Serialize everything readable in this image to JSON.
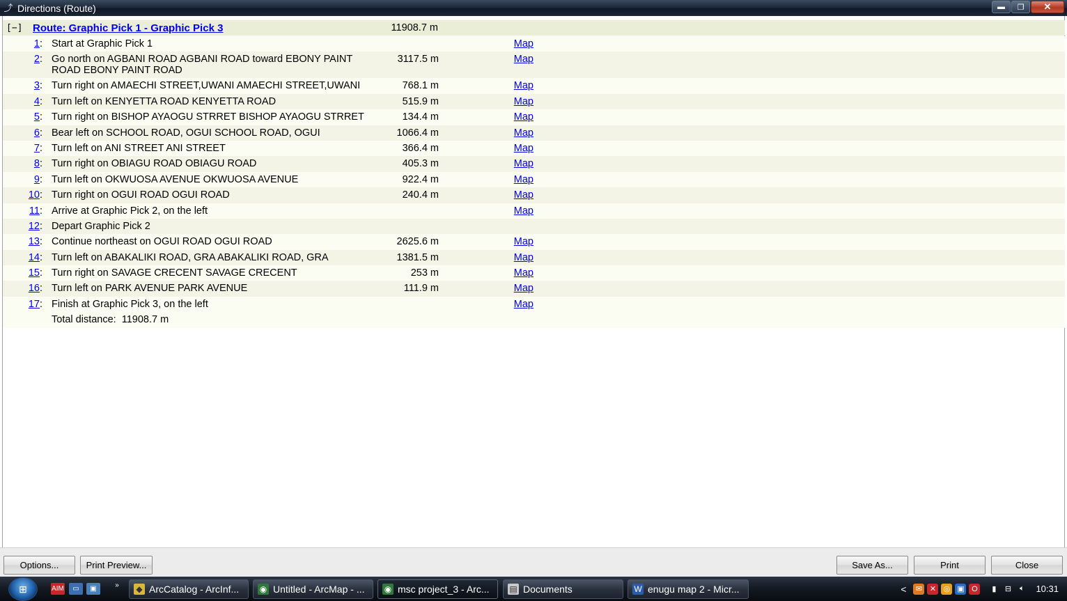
{
  "window": {
    "title": "Directions (Route)",
    "minimize": "▬",
    "restore": "❐",
    "close": "✕"
  },
  "route": {
    "collapse": "[−]",
    "title": "Route: Graphic Pick 1 - Graphic Pick 3",
    "total": "11908.7 m"
  },
  "steps": [
    {
      "num": "1",
      "desc": "Start at Graphic Pick 1",
      "dist": "",
      "map": "Map"
    },
    {
      "num": "2",
      "desc": "Go north on AGBANI ROAD AGBANI ROAD toward EBONY PAINT ROAD EBONY PAINT ROAD",
      "dist": "3117.5 m",
      "map": "Map"
    },
    {
      "num": "3",
      "desc": "Turn right on AMAECHI STREET,UWANI AMAECHI STREET,UWANI",
      "dist": "768.1 m",
      "map": "Map"
    },
    {
      "num": "4",
      "desc": "Turn left on KENYETTA ROAD KENYETTA ROAD",
      "dist": "515.9 m",
      "map": "Map"
    },
    {
      "num": "5",
      "desc": "Turn right on BISHOP AYAOGU STRRET BISHOP AYAOGU STRRET",
      "dist": "134.4 m",
      "map": "Map"
    },
    {
      "num": "6",
      "desc": "Bear left on SCHOOL ROAD, OGUI SCHOOL ROAD, OGUI",
      "dist": "1066.4 m",
      "map": "Map"
    },
    {
      "num": "7",
      "desc": "Turn left on ANI STREET ANI STREET",
      "dist": "366.4 m",
      "map": "Map"
    },
    {
      "num": "8",
      "desc": "Turn right on OBIAGU ROAD OBIAGU ROAD",
      "dist": "405.3 m",
      "map": "Map"
    },
    {
      "num": "9",
      "desc": "Turn left on OKWUOSA AVENUE OKWUOSA AVENUE",
      "dist": "922.4 m",
      "map": "Map"
    },
    {
      "num": "10",
      "desc": "Turn right on OGUI ROAD OGUI ROAD",
      "dist": "240.4 m",
      "map": "Map"
    },
    {
      "num": "11",
      "desc": "Arrive at Graphic Pick 2, on the left",
      "dist": "",
      "map": "Map"
    },
    {
      "num": "12",
      "desc": "Depart Graphic Pick 2",
      "dist": "",
      "map": ""
    },
    {
      "num": "13",
      "desc": "Continue northeast on OGUI ROAD OGUI ROAD",
      "dist": "2625.6 m",
      "map": "Map"
    },
    {
      "num": "14",
      "desc": "Turn left on ABAKALIKI ROAD, GRA ABAKALIKI ROAD, GRA",
      "dist": "1381.5 m",
      "map": "Map"
    },
    {
      "num": "15",
      "desc": "Turn right on SAVAGE CRECENT SAVAGE CRECENT",
      "dist": "253 m",
      "map": "Map"
    },
    {
      "num": "16",
      "desc": "Turn left on PARK AVENUE PARK AVENUE",
      "dist": "111.9 m",
      "map": "Map"
    },
    {
      "num": "17",
      "desc": "Finish at Graphic Pick 3, on the left",
      "dist": "",
      "map": "Map"
    }
  ],
  "total_line": "Total distance:  11908.7 m",
  "buttons": {
    "options": "Options...",
    "print_preview": "Print Preview...",
    "save_as": "Save As...",
    "print": "Print",
    "close": "Close"
  },
  "taskbar": {
    "start_icon": "start-orb-icon",
    "chevron": "»",
    "tasks": [
      {
        "label": "ArcCatalog - ArcInf...",
        "icon": "arccatalog-icon"
      },
      {
        "label": "Untitled - ArcMap - ...",
        "icon": "arcmap-icon"
      },
      {
        "label": "msc project_3 - Arc...",
        "icon": "arcmap-icon"
      },
      {
        "label": "Documents",
        "icon": "folder-icon"
      },
      {
        "label": "enugu map 2 - Micr...",
        "icon": "word-icon"
      }
    ],
    "tray_chevron": "<",
    "clock": "10:31"
  }
}
